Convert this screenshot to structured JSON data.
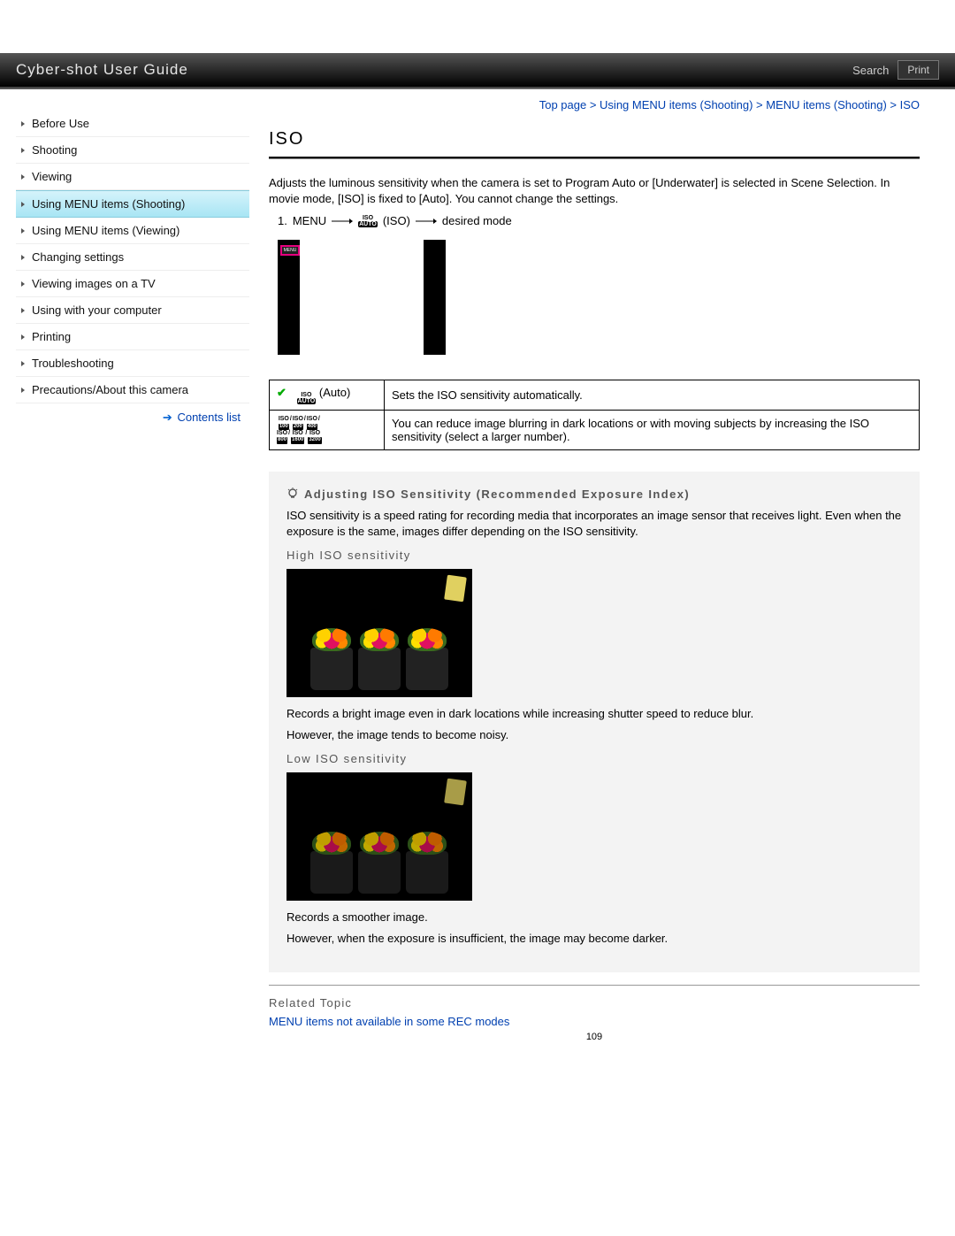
{
  "header": {
    "title": "Cyber-shot User Guide",
    "search": "Search",
    "print": "Print"
  },
  "sidebar": {
    "items": [
      {
        "label": "Before Use"
      },
      {
        "label": "Shooting"
      },
      {
        "label": "Viewing"
      },
      {
        "label": "Using MENU items (Shooting)"
      },
      {
        "label": "Using MENU items (Viewing)"
      },
      {
        "label": "Changing settings"
      },
      {
        "label": "Viewing images on a TV"
      },
      {
        "label": "Using with your computer"
      },
      {
        "label": "Printing"
      },
      {
        "label": "Troubleshooting"
      },
      {
        "label": "Precautions/About this camera"
      }
    ],
    "contents_list": "Contents list"
  },
  "breadcrumb": "Top page > Using MENU items (Shooting) > MENU items (Shooting) > ISO",
  "page_title": "ISO",
  "intro": "Adjusts the luminous sensitivity when the camera is set to Program Auto or [Underwater] is selected in Scene Selection. In movie mode, [ISO] is fixed to [Auto]. You cannot change the settings.",
  "step": {
    "num": "1.",
    "menu": "MENU",
    "iso": "(ISO)",
    "desired": "desired mode"
  },
  "screen_menu": "MENU",
  "table": {
    "row1": {
      "label": "(Auto)",
      "desc": "Sets the ISO sensitivity automatically."
    },
    "row2": {
      "desc": "You can reduce image blurring in dark locations or with moving subjects by increasing the ISO sensitivity (select a larger number)."
    }
  },
  "tip": {
    "heading": "Adjusting ISO Sensitivity (Recommended Exposure Index)",
    "para1": "ISO sensitivity is a speed rating for recording media that incorporates an image sensor that receives light. Even when the exposure is the same, images differ depending on the ISO sensitivity.",
    "high_h": "High ISO sensitivity",
    "high_desc1": "Records a bright image even in dark locations while increasing shutter speed to reduce blur.",
    "high_desc2": "However, the image tends to become noisy.",
    "low_h": "Low ISO sensitivity",
    "low_desc1": "Records a smoother image.",
    "low_desc2": "However, when the exposure is insufficient, the image may become darker."
  },
  "related": {
    "heading": "Related Topic",
    "link": "MENU items not available in some REC modes"
  },
  "page_number": "109",
  "iso_values": [
    "100",
    "200",
    "400",
    "800",
    "1600",
    "3200"
  ]
}
